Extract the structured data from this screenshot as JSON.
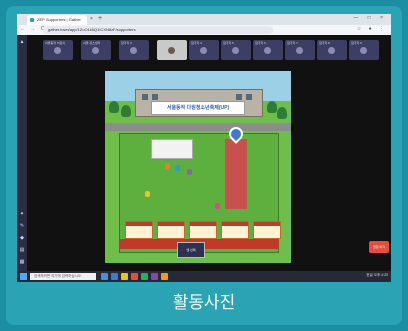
{
  "browser": {
    "tab_title": "ZEP Supporters | Gather",
    "tab_close": "×",
    "tab_new": "+",
    "window_controls": "— □ ×",
    "nav": "← → C",
    "url": "gather.town/app/1ZuO1k5Q1ICXN8zF/supporters",
    "addr_icons": "☆ ● ⋮"
  },
  "left_toolbar": {
    "icons": [
      "home-icon",
      "gear-icon",
      "tool-icon",
      "chat-icon",
      "calendar-icon",
      "grid-icon"
    ]
  },
  "video_tiles": [
    {
      "name": "서울동작 어린이"
    },
    {
      "name": "서울 유스센터"
    },
    {
      "name": "참가자 3"
    },
    {
      "name": "참가자 4"
    },
    {
      "name": "참가자 5"
    },
    {
      "name": "참가자 6"
    },
    {
      "name": "참가자 7"
    },
    {
      "name": "참가자 8"
    },
    {
      "name": "참가자 9"
    }
  ],
  "map": {
    "banner": "서울동작 다원청소년축제(UP)"
  },
  "bottom": {
    "center_button": "맵 선택",
    "right_chip": "입장 하기"
  },
  "taskbar": {
    "search_placeholder": "검색하려면 여기에 입력하십시오.",
    "tray": "한글 오후 4:20"
  },
  "caption": "활동사진"
}
